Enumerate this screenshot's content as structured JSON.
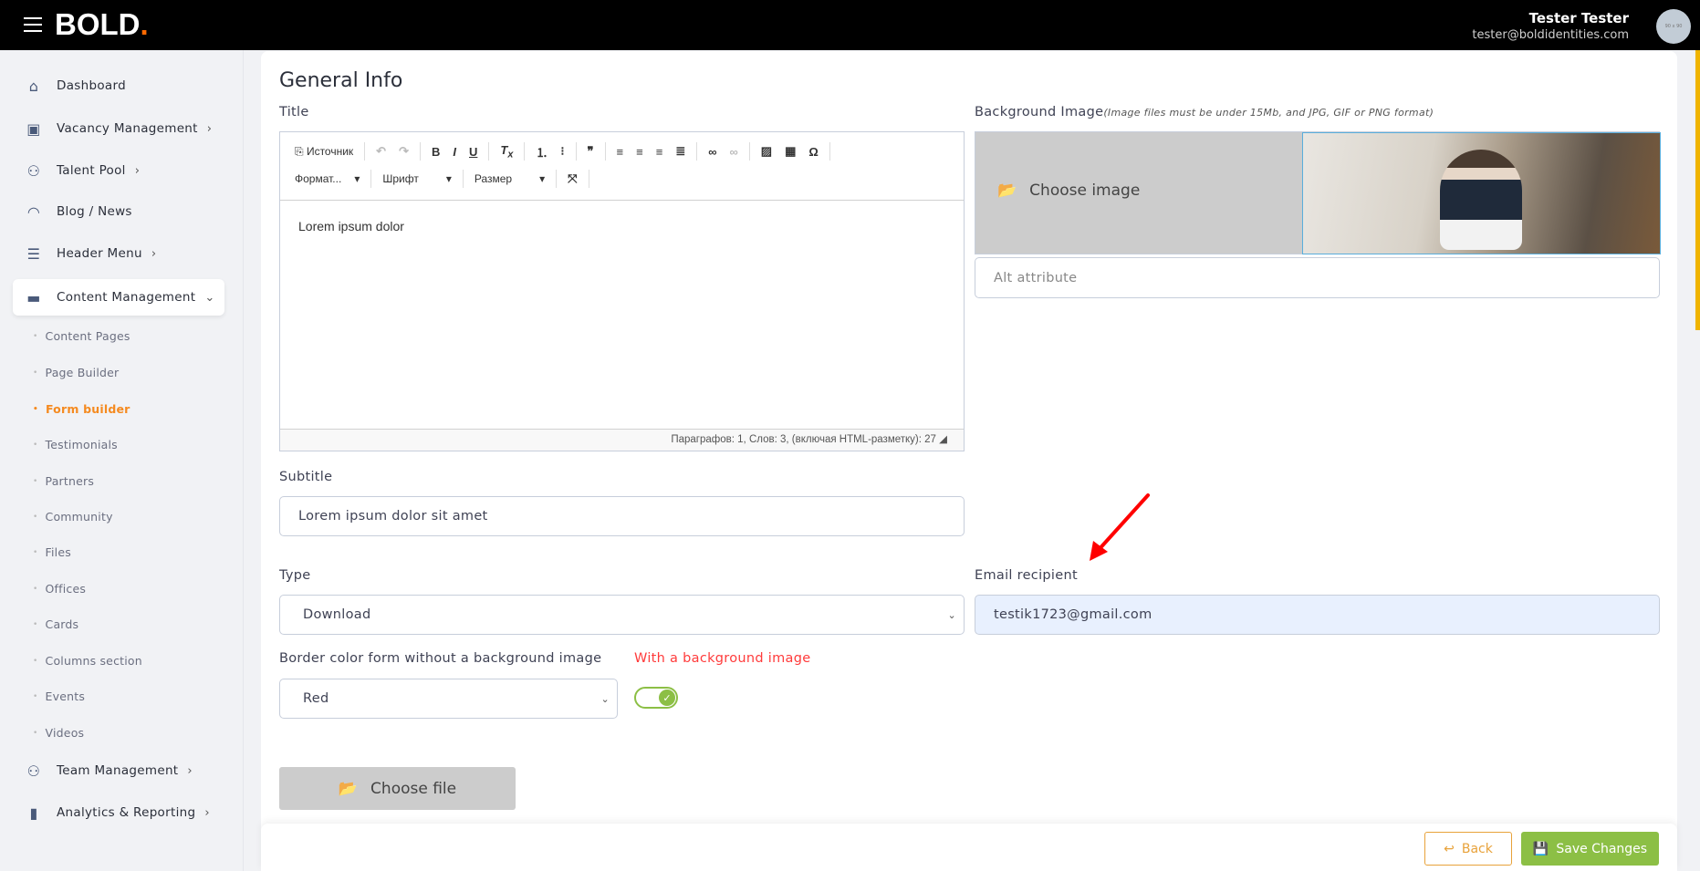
{
  "header": {
    "logo": "BOLD",
    "logo_dot": ".",
    "user_name": "Tester Tester",
    "user_email": "tester@boldidentities.com",
    "avatar_text": "90 x 90"
  },
  "sidebar": {
    "items": [
      {
        "label": "Dashboard",
        "icon": "home-icon",
        "glyph": "⌂"
      },
      {
        "label": "Vacancy Management",
        "icon": "briefcase-icon",
        "glyph": "▣",
        "chev": "›"
      },
      {
        "label": "Talent Pool",
        "icon": "user-plus-icon",
        "glyph": "⚇",
        "chev": "›"
      },
      {
        "label": "Blog / News",
        "icon": "rss-icon",
        "glyph": "◠"
      },
      {
        "label": "Header Menu",
        "icon": "menu-icon",
        "glyph": "☰",
        "chev": "›"
      },
      {
        "label": "Content Management",
        "icon": "monitor-icon",
        "glyph": "▬",
        "chev": "⌄"
      },
      {
        "label": "Team Management",
        "icon": "users-icon",
        "glyph": "⚇",
        "chev": "›"
      },
      {
        "label": "Analytics & Reporting",
        "icon": "bar-chart-icon",
        "glyph": "▮",
        "chev": "›"
      }
    ],
    "sub_items": [
      "Content Pages",
      "Page Builder",
      "Form builder",
      "Testimonials",
      "Partners",
      "Community",
      "Files",
      "Offices",
      "Cards",
      "Columns section",
      "Events",
      "Videos"
    ],
    "active_sub": "Form builder"
  },
  "main": {
    "title": "General Info",
    "title_label": "Title",
    "editor": {
      "source": "Источник",
      "format": "Формат...",
      "font": "Шрифт",
      "size": "Размер",
      "content": "Lorem ipsum dolor",
      "status": "Параграфов: 1, Слов: 3, (включая HTML-разметку): 27"
    },
    "bg_label": "Background Image",
    "bg_hint": "(Image files must be under 15Mb, and JPG, GIF or PNG format)",
    "choose_image": "Choose image",
    "alt_placeholder": "Alt attribute",
    "subtitle_label": "Subtitle",
    "subtitle_value": "Lorem ipsum dolor sit amet",
    "type_label": "Type",
    "type_value": "Download",
    "email_label": "Email recipient",
    "email_value": "testik1723@gmail.com",
    "border_label": "Border color form without a background image",
    "border_value": "Red",
    "with_bg_label": "With a background image",
    "with_bg_toggle": true,
    "choose_file": "Choose file"
  },
  "footer": {
    "back": "Back",
    "save": "Save Changes"
  },
  "colors": {
    "accent_orange": "#f58a1f",
    "save_green": "#8cbf45",
    "back_orange": "#e8a23a",
    "warning_red": "#ff3b3b",
    "autofill_blue": "#e8f0fe"
  }
}
